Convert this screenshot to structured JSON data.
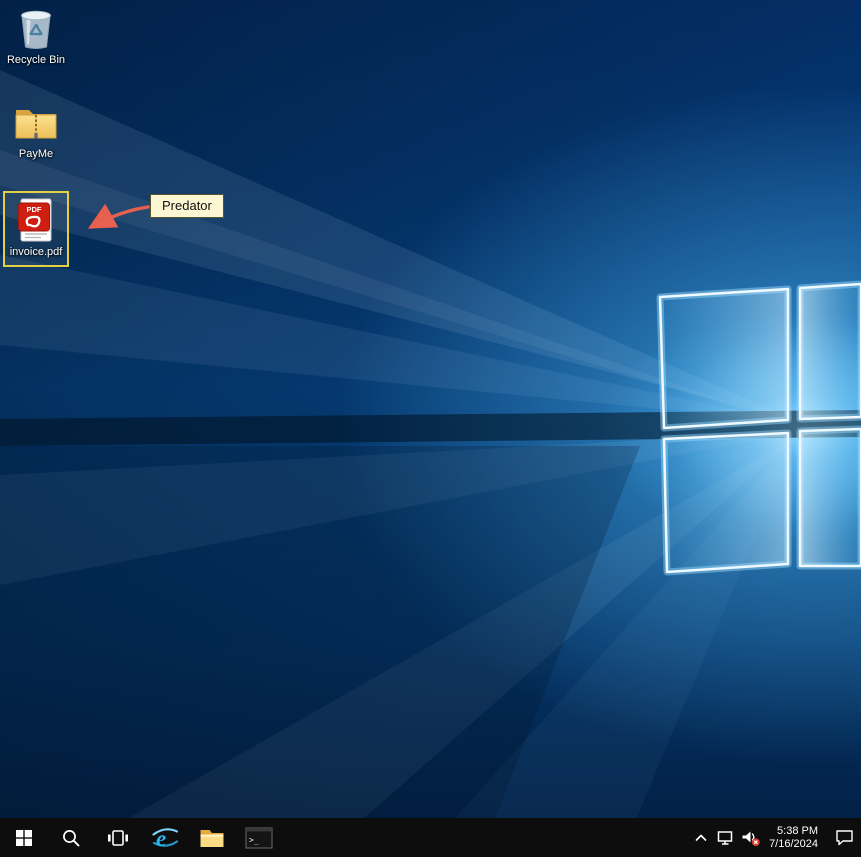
{
  "desktop": {
    "icons": [
      {
        "id": "recycle-bin",
        "label": "Recycle Bin"
      },
      {
        "id": "payme",
        "label": "PayMe"
      },
      {
        "id": "invoice",
        "label": "invoice.pdf",
        "selected": true
      }
    ],
    "pdf_icon_text": "PDF",
    "annotation": {
      "label": "Predator"
    }
  },
  "taskbar": {
    "clock_time": "5:38 PM",
    "clock_date": "7/16/2024"
  },
  "colors": {
    "selection_border": "#e3cf43",
    "annotation_background": "#fdf6d2",
    "annotation_border": "#55552e",
    "arrow": "#e8604f",
    "taskbar_background": "#0d0d0d",
    "wallpaper_accent": "#4db5f2",
    "volume_error_badge": "#d83b2e"
  }
}
